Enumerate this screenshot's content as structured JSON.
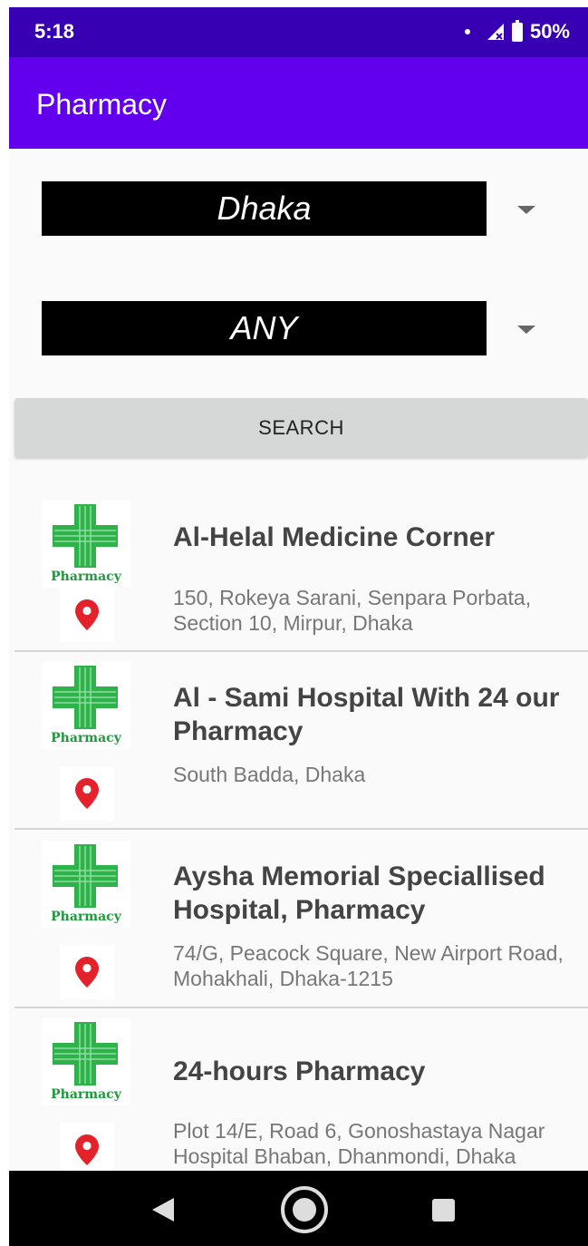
{
  "status_bar": {
    "time": "5:18",
    "battery": "50%"
  },
  "app_bar": {
    "title": "Pharmacy"
  },
  "filters": {
    "city": "Dhaka",
    "area": "ANY",
    "search_label": "SEARCH"
  },
  "pharmacies": [
    {
      "logo_label": "Pharmacy",
      "name": "Al-Helal Medicine Corner",
      "address": "150, Rokeya Sarani, Senpara Porbata, Section 10, Mirpur, Dhaka"
    },
    {
      "logo_label": "Pharmacy",
      "name": "Al - Sami Hospital With 24 our Pharmacy",
      "address": "South Badda, Dhaka"
    },
    {
      "logo_label": "Pharmacy",
      "name": "Aysha Memorial Speciallised Hospital, Pharmacy",
      "address": "74/G, Peacock Square, New Airport Road, Mohakhali, Dhaka-1215"
    },
    {
      "logo_label": "Pharmacy",
      "name": "24-hours Pharmacy",
      "address": "Plot 14/E, Road 6, Gonoshastaya Nagar Hospital Bhaban, Dhanmondi, Dhaka"
    }
  ],
  "colors": {
    "status_bar": "#3700b3",
    "app_bar": "#6200ee",
    "cross_green": "#2eb34a",
    "pin_red": "#e3222b"
  }
}
